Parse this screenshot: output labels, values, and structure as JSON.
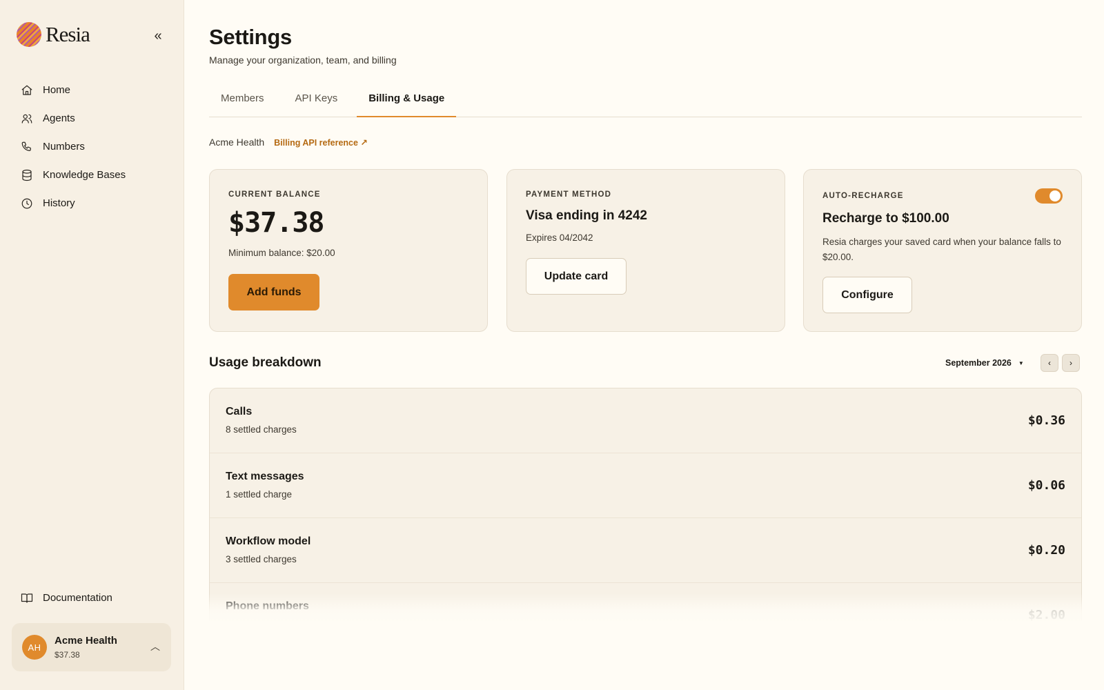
{
  "app": {
    "logo_text": "Resia",
    "collapse_icon": "chevrons-left-icon"
  },
  "sidebar": {
    "items": [
      {
        "label": "Home",
        "icon": "home-icon"
      },
      {
        "label": "Agents",
        "icon": "users-icon"
      },
      {
        "label": "Numbers",
        "icon": "phone-icon"
      },
      {
        "label": "Knowledge Bases",
        "icon": "database-icon"
      },
      {
        "label": "History",
        "icon": "clock-icon"
      }
    ],
    "docs_label": "Documentation",
    "account": {
      "initials": "AH",
      "name": "Acme Health",
      "balance": "$37.38"
    }
  },
  "header": {
    "title": "Settings",
    "subtitle": "Manage your organization, team, and billing"
  },
  "tabs": [
    {
      "label": "Members",
      "active": false
    },
    {
      "label": "API Keys",
      "active": false
    },
    {
      "label": "Billing & Usage",
      "active": true
    }
  ],
  "billing": {
    "org_name": "Acme Health",
    "api_link": "Billing API reference ↗",
    "balance_card": {
      "label": "CURRENT BALANCE",
      "amount": "$37.38",
      "min_note": "Minimum balance: $20.00",
      "button": "Add funds"
    },
    "payment_card": {
      "label": "PAYMENT METHOD",
      "title": "Visa ending in 4242",
      "expires": "Expires 04/2042",
      "button": "Update card"
    },
    "recharge_card": {
      "label": "AUTO-RECHARGE",
      "enabled": true,
      "title": "Recharge to $100.00",
      "description": "Resia charges your saved card when your balance falls to $20.00.",
      "button": "Configure"
    }
  },
  "usage": {
    "title": "Usage breakdown",
    "month": "September 2026",
    "rows": [
      {
        "name": "Calls",
        "sub": "8 settled charges",
        "amount": "$0.36"
      },
      {
        "name": "Text messages",
        "sub": "1 settled charge",
        "amount": "$0.06"
      },
      {
        "name": "Workflow model",
        "sub": "3 settled charges",
        "amount": "$0.20"
      },
      {
        "name": "Phone numbers",
        "sub": "",
        "amount": "$2.00"
      }
    ]
  },
  "colors": {
    "accent": "#e08a2c",
    "sidebar_bg": "#f7f0e4",
    "page_bg": "#fffcf5",
    "card_bg": "#f7f1e6",
    "link": "#b56a12"
  }
}
